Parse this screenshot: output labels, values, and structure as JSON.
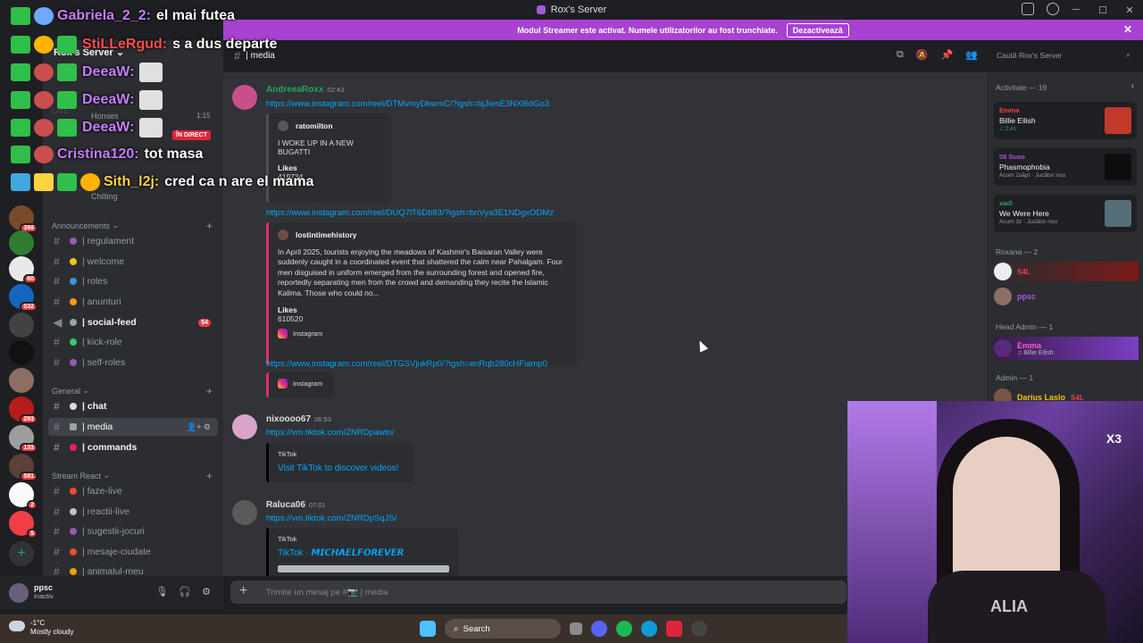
{
  "window": {
    "title": "Rox's Server"
  },
  "banner": {
    "text": "Modul Streamer este activat. Numele utilizatorilor au fost trunchiate.",
    "button": "Dezactivează"
  },
  "guild_badges": [
    "398",
    "60",
    "532",
    "293",
    "133",
    "581",
    "2",
    "5"
  ],
  "server": {
    "name": "Rox's Server"
  },
  "categories": {
    "announcements": "Announcements",
    "general": "General",
    "stream_react": "Stream React"
  },
  "hidden_channels": {
    "homies": "Homies",
    "time": "1:15",
    "chilling": "Chilling",
    "live": "LIVE"
  },
  "channels": {
    "regulament": "| regulament",
    "welcome": "| welcome",
    "roles": "| roles",
    "anunturi": "| anunturi",
    "social_feed": "| social-feed",
    "social_feed_badge": "54",
    "kick_role": "| kick-role",
    "self_roles": "| self-roles",
    "chat": "| chat",
    "media": "| media",
    "commands": "| commands",
    "faze_live": "| faze-live",
    "reactii_live": "| reactii-live",
    "sugestii_jocuri": "| sugestii-jocuri",
    "mesaje_ciudate": "| mesaje-ciudate",
    "animalul_meu": "| animalul-meu"
  },
  "user": {
    "name": "ppsc",
    "status": "Inactiv"
  },
  "chat_header": {
    "channel": "| media"
  },
  "search": {
    "placeholder": "Caută Rox's Server"
  },
  "messages": [
    {
      "author": "AndreeaRoxx",
      "time": "02:43",
      "link1": "https://www.instagram.com/reel/DTMvmyDkwmC/?igsh=bjJienE3NXl6dGo3",
      "embed1": {
        "author": "ratomilton",
        "text": "I WOKE UP IN A NEW BUGATTI",
        "likes_label": "Likes",
        "likes": "419734"
      },
      "link2": "https://www.instagram.com/reel/DUQ7lT6Db83/?igsh=bnVya3E1NDgxODMz",
      "embed2": {
        "author": "lostintimehistory",
        "text": "In April 2025, tourists enjoying the meadows of Kashmir's Baisaran Valley were suddenly caught in a coordinated event that shattered the calm near Pahalgam. Four men disguised in uniform emerged from the surrounding forest and opened fire, reportedly separating men from the crowd and demanding they recite the Islamic Kalima. Those who could no...",
        "likes_label": "Likes",
        "likes": "610520",
        "footer": "Instagram"
      },
      "link3": "https://www.instagram.com/reel/DTGSVjukRp0/?igsh=enRqb280cHFiamp0",
      "embed3": {
        "footer": "Instagram"
      }
    },
    {
      "author": "nixoooo67",
      "time": "06:53",
      "link": "https://vm.tiktok.com/ZNRDpawto/",
      "embed": {
        "provider": "TikTok",
        "title": "Visit TikTok to discover videos!"
      }
    },
    {
      "author": "Raluca06",
      "time": "07:01",
      "link": "https://vm.tiktok.com/ZNRDpSqJS/",
      "embed": {
        "provider": "TikTok",
        "title": "TikTok · 𝙈𝙄𝘾𝙃𝘼𝙀𝙇𝙁𝙊𝙍𝙀𝙑𝙀𝙍"
      }
    }
  ],
  "composer": {
    "placeholder": "Trimite un mesaj pe #📷 | media"
  },
  "members": {
    "activity_header": "Activitate — 19",
    "activities": [
      {
        "name": "Emma",
        "game": "Billie Eilish",
        "sub": "♫ 2:41"
      },
      {
        "name": "08 Suso",
        "game": "Phasmophobia",
        "sub": "Acum 2săpt · Jucător nou"
      },
      {
        "name": "xadi",
        "game": "We Were Here",
        "sub": "Acum 3z · Jucător nou"
      }
    ],
    "roxana_header": "Roxana — 2",
    "roxana_tag": "S4L",
    "roxana_member2": "ppsc",
    "head_admin_header": "Head Admin — 1",
    "head_admin": {
      "name": "Emma",
      "sub": "♫ Billie Eilish"
    },
    "admin_header": "Admin — 1",
    "admin": {
      "name": "Darius Laslo",
      "tag": "S4L"
    }
  },
  "overlay": {
    "lines": [
      {
        "user": "Gabriela_2_2:",
        "text": "el mai futea",
        "color": "#c77dff"
      },
      {
        "user": "StiLLeRgud:",
        "text": "s a dus departe",
        "color": "#ff4f4f"
      },
      {
        "user": "DeeaW:",
        "text": "",
        "color": "#c77dff"
      },
      {
        "user": "DeeaW:",
        "text": "",
        "color": "#c77dff"
      },
      {
        "user": "DeeaW:",
        "text": "",
        "color": "#c77dff"
      },
      {
        "user": "Cristina120:",
        "text": "tot masa",
        "color": "#c77dff"
      },
      {
        "user": "Sith_l2j:",
        "text": "cred ca n are el mama",
        "color": "#ffd23f"
      }
    ],
    "live_badge": "ÎN DIRECT",
    "camera_multiplier": "X3",
    "shirt_text": "ALIA"
  },
  "taskbar": {
    "temp": "-1°C",
    "weather": "Mostly cloudy",
    "search": "Search"
  },
  "colors": {
    "brand": "#a742d1",
    "link": "#00a8fc",
    "sidebar": "#2b2d31",
    "chat_bg": "#313338"
  }
}
